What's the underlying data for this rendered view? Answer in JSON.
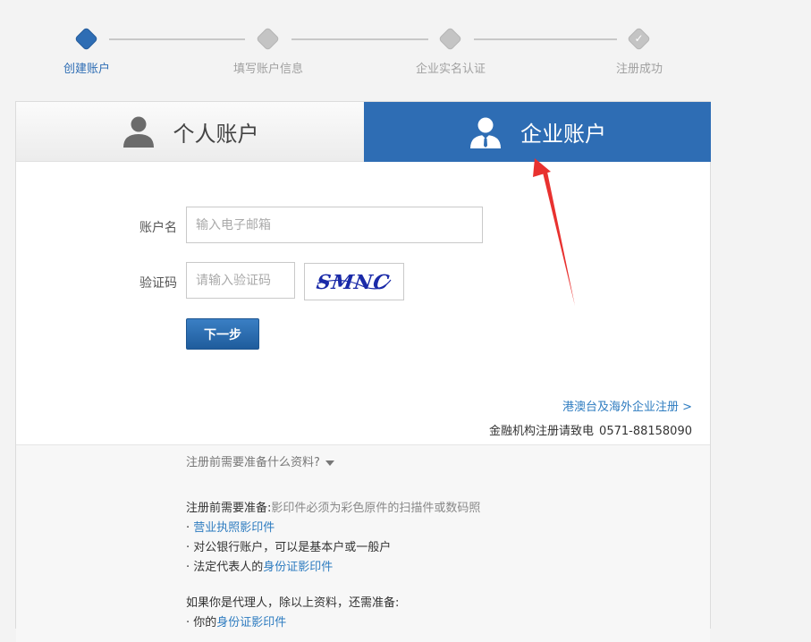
{
  "steps": [
    {
      "label": "创建账户",
      "state": "active"
    },
    {
      "label": "填写账户信息",
      "state": "pending"
    },
    {
      "label": "企业实名认证",
      "state": "pending"
    },
    {
      "label": "注册成功",
      "state": "done"
    }
  ],
  "tabs": {
    "personal": "个人账户",
    "enterprise": "企业账户",
    "active": "enterprise"
  },
  "form": {
    "account_label": "账户名",
    "account_placeholder": "输入电子邮箱",
    "captcha_label": "验证码",
    "captcha_placeholder": "请输入验证码",
    "captcha_text": "SMNC",
    "next_button": "下一步"
  },
  "links": {
    "hk_overseas": "港澳台及海外企业注册 >",
    "financial_text": "金融机构注册请致电",
    "financial_phone": "0571-88158090"
  },
  "prep": {
    "header": "注册前需要准备什么资料?",
    "intro_label": "注册前需要准备:",
    "intro_note": "影印件必须为彩色原件的扫描件或数码照",
    "item1": "营业执照影印件",
    "item2": "对公银行账户，可以是基本户或一般户",
    "item3_prefix": "法定代表人的",
    "item3_link": "身份证影印件",
    "agent_intro": "如果你是代理人，除以上资料，还需准备:",
    "agent_item1_prefix": "你的",
    "agent_item1_link": "身份证影印件"
  },
  "colors": {
    "primary": "#2e6db4",
    "link": "#2e7cc0",
    "annotation_arrow": "#e8312f"
  }
}
